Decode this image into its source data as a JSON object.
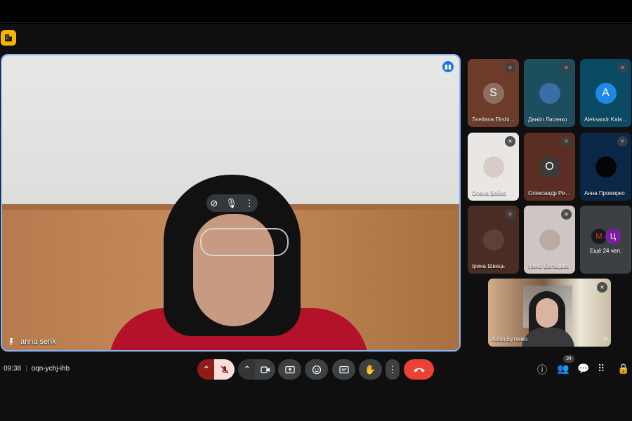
{
  "meeting": {
    "time": "09:38",
    "separator": "|",
    "code": "oqn-ychj-ihb"
  },
  "main_tile": {
    "participant_name": "anna serik",
    "pin_icon": "pin-icon",
    "speaking_indicator": "audio-wave-icon"
  },
  "tiles": [
    {
      "name": "Svetlana Ekshtein",
      "initial": "S",
      "avatar_color": "#8d6e63",
      "bg": "#6d3b2a",
      "mic": "muted-red"
    },
    {
      "name": "Данііл Лисенко",
      "initial": "",
      "avatar_color": "#3a6ea5",
      "bg": "#1d4e5e",
      "mic": "muted-blue"
    },
    {
      "name": "Aleksandr Kalashnikov",
      "initial": "A",
      "avatar_color": "#1e88e5",
      "bg": "#0b4a63",
      "mic": "muted-blue"
    },
    {
      "name": "Олена Бойко",
      "initial": "",
      "avatar_color": "#d7ccc8",
      "bg": "#e9e6e3",
      "mic": "muted-gray"
    },
    {
      "name": "Олександр Рибалко",
      "initial": "О",
      "avatar_color": "#3b3b3b",
      "bg": "#5a2e22",
      "mic": "muted-red"
    },
    {
      "name": "Анна Прожирко",
      "initial": "",
      "avatar_color": "#050505",
      "bg": "#0b2748",
      "mic": "muted-blue"
    },
    {
      "name": "Ірина Швець",
      "initial": "",
      "avatar_color": "#5d4037",
      "bg": "#4a2c22",
      "mic": "muted-red"
    },
    {
      "name": "Ірина Балацька",
      "initial": "",
      "avatar_color": "#bcaaa4",
      "bg": "#cfc6c3",
      "mic": "muted-gray"
    }
  ],
  "more_tile": {
    "text": "Ещё 24 чел.",
    "avatar1_letter": "M",
    "avatar2_letter": "Ц"
  },
  "self_tile": {
    "name": "Юлія Бутенко"
  },
  "controls": {
    "participants_count": "34"
  },
  "colors": {
    "accent": "#8ab4f8",
    "end_call": "#ea4335",
    "mic_off_bg": "#f9dedc",
    "badge": "#f4b400"
  }
}
